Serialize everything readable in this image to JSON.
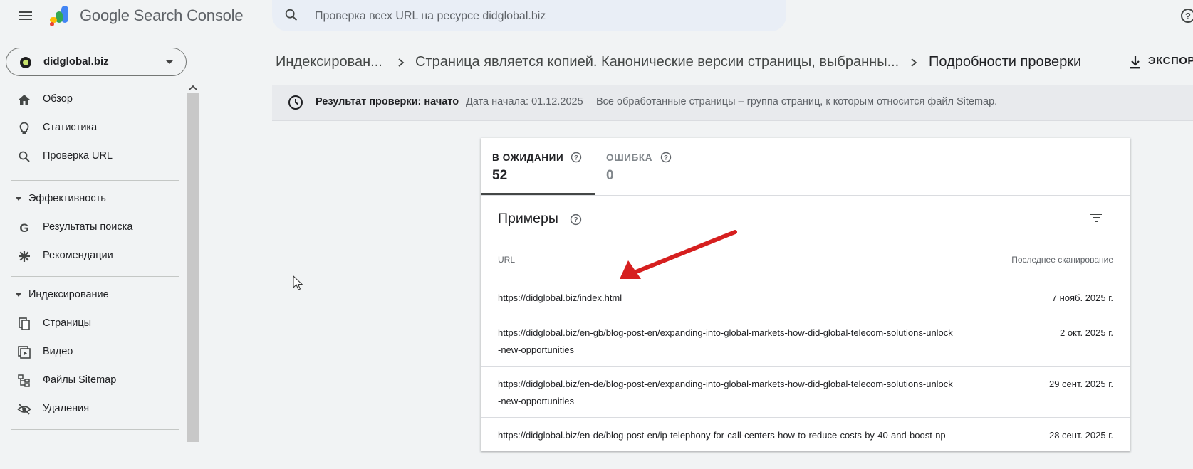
{
  "header": {
    "app_title": "Google Search Console",
    "search_placeholder": "Проверка всех URL на ресурсе didglobal.biz"
  },
  "property": {
    "name": "didglobal.biz"
  },
  "sidebar": {
    "top_items": [
      {
        "label": "Обзор",
        "icon": "home-icon"
      },
      {
        "label": "Статистика",
        "icon": "lightbulb-icon"
      },
      {
        "label": "Проверка URL",
        "icon": "search-icon"
      }
    ],
    "sections": [
      {
        "title": "Эффективность",
        "items": [
          {
            "label": "Результаты поиска",
            "icon": "google-g-icon"
          },
          {
            "label": "Рекомендации",
            "icon": "asterisk-icon"
          }
        ]
      },
      {
        "title": "Индексирование",
        "items": [
          {
            "label": "Страницы",
            "icon": "pages-icon"
          },
          {
            "label": "Видео",
            "icon": "video-icon"
          },
          {
            "label": "Файлы Sitemap",
            "icon": "sitemap-icon"
          },
          {
            "label": "Удаления",
            "icon": "eye-off-icon"
          }
        ]
      }
    ]
  },
  "breadcrumbs": [
    "Индексирован...",
    "Страница является копией. Канонические версии страницы, выбранны...",
    "Подробности проверки"
  ],
  "export_label": "ЭКСПОРТ",
  "banner": {
    "result": "Результат проверки: начато",
    "date": "Дата начала: 01.12.2025",
    "description": "Все обработанные страницы – группа страниц, к которым относится файл Sitemap."
  },
  "tabs": [
    {
      "label": "В ОЖИДАНИИ",
      "value": "52"
    },
    {
      "label": "ОШИБКА",
      "value": "0"
    }
  ],
  "examples": {
    "title": "Примеры",
    "col_url": "URL",
    "col_date": "Последнее сканирование",
    "rows": [
      {
        "url": "https://didglobal.biz/index.html",
        "date": "7 нояб. 2025 г."
      },
      {
        "url": "https://didglobal.biz/en-gb/blog-post-en/expanding-into-global-markets-how-did-global-telecom-solutions-unlock-new-opportunities",
        "date": "2 окт. 2025 г."
      },
      {
        "url": "https://didglobal.biz/en-de/blog-post-en/expanding-into-global-markets-how-did-global-telecom-solutions-unlock-new-opportunities",
        "date": "29 сент. 2025 г."
      },
      {
        "url": "https://didglobal.biz/en-de/blog-post-en/ip-telephony-for-call-centers-how-to-reduce-costs-by-40-and-boost-np",
        "date": "28 сент. 2025 г."
      }
    ]
  },
  "colors": {
    "annotation_arrow": "#d61f1f",
    "brand_blue": "#4285f4"
  }
}
